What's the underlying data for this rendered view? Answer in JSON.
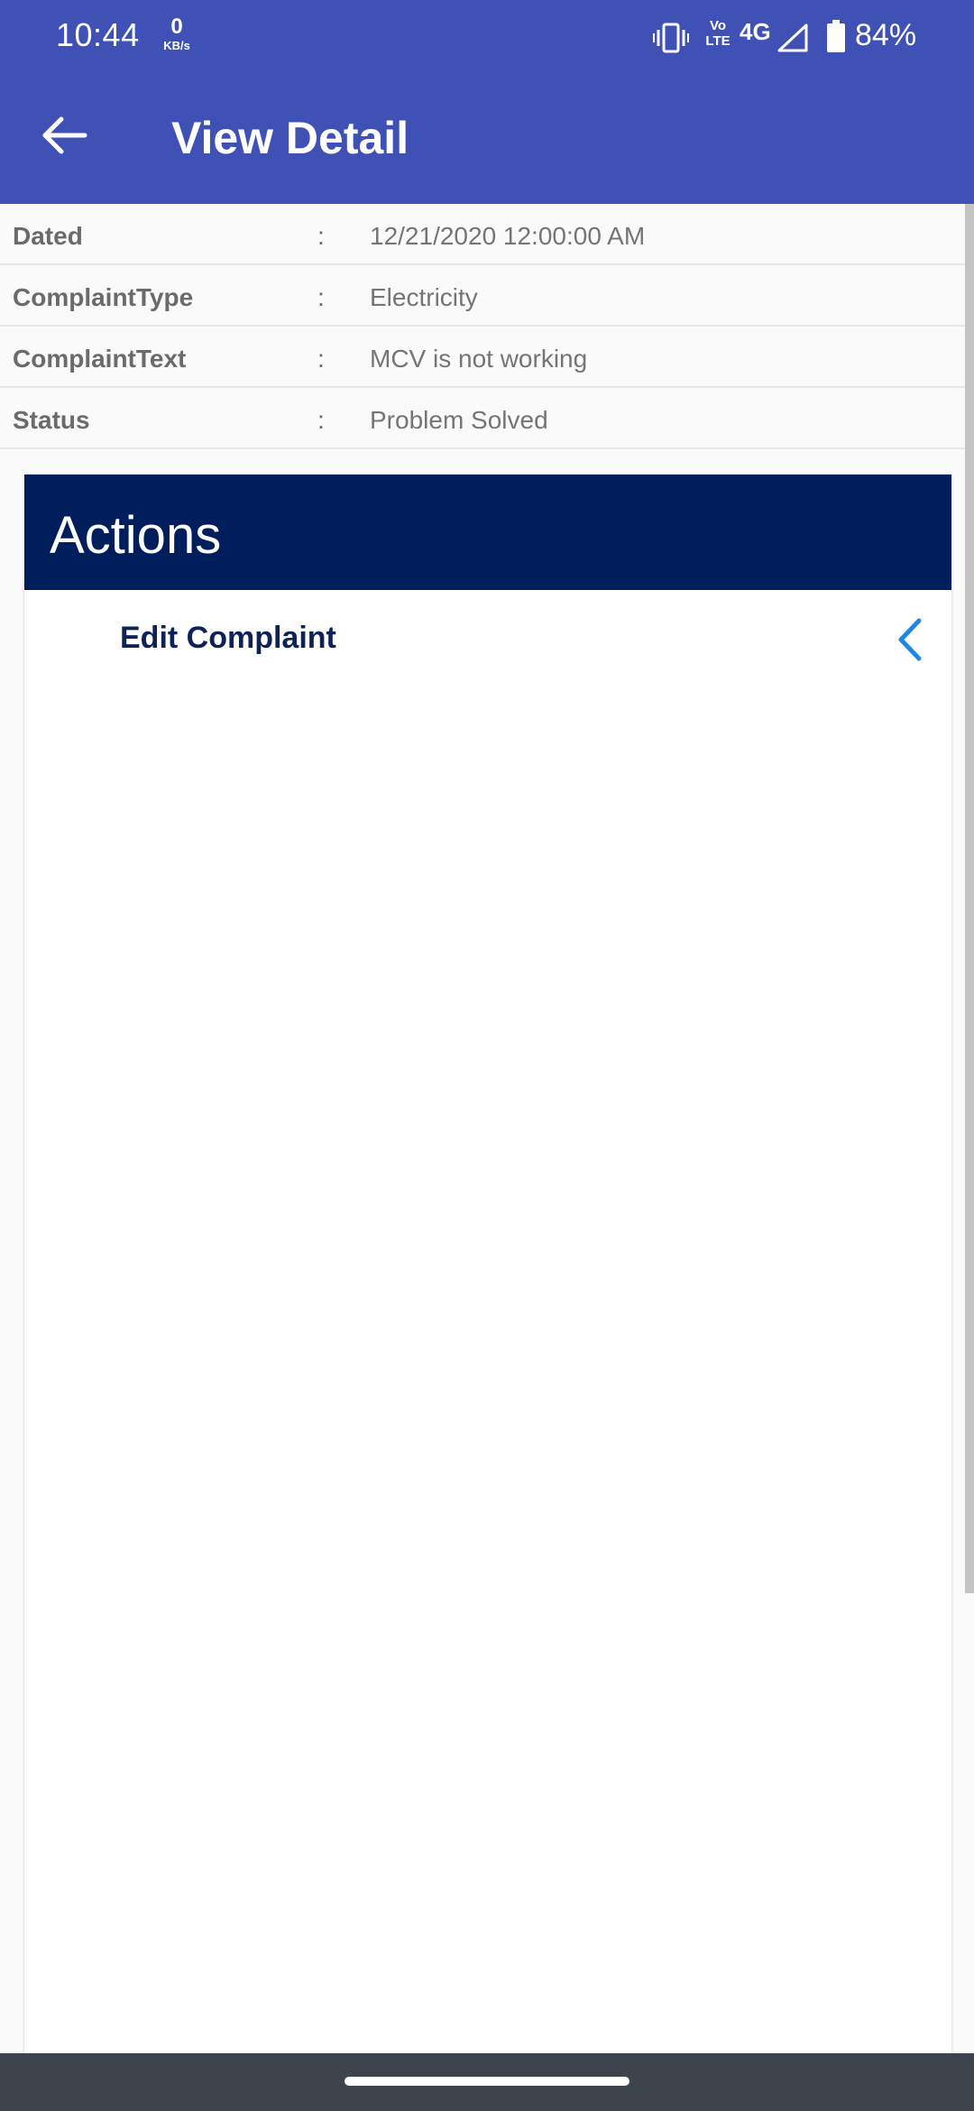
{
  "status_bar": {
    "time": "10:44",
    "net_speed_value": "0",
    "net_speed_unit": "KB/s",
    "volte_top": "Vo",
    "volte_bottom": "LTE",
    "network_type": "4G",
    "battery": "84%"
  },
  "app_bar": {
    "title": "View Detail",
    "back_icon": "arrow-left-icon"
  },
  "details": [
    {
      "label": "Dated",
      "separator": ":",
      "value": "12/21/2020 12:00:00 AM"
    },
    {
      "label": "ComplaintType",
      "separator": ":",
      "value": "Electricity"
    },
    {
      "label": "ComplaintText",
      "separator": ":",
      "value": "MCV is not working"
    },
    {
      "label": "Status",
      "separator": ":",
      "value": "Problem Solved"
    }
  ],
  "actions": {
    "title": "Actions",
    "items": [
      {
        "label": "Edit Complaint",
        "icon": "chevron-left-icon"
      }
    ]
  },
  "colors": {
    "app_bar": "#3f51b5",
    "actions_header": "#001e5b",
    "action_text": "#0d2257",
    "chevron": "#1e88e5",
    "nav_bar": "#3d434a"
  }
}
